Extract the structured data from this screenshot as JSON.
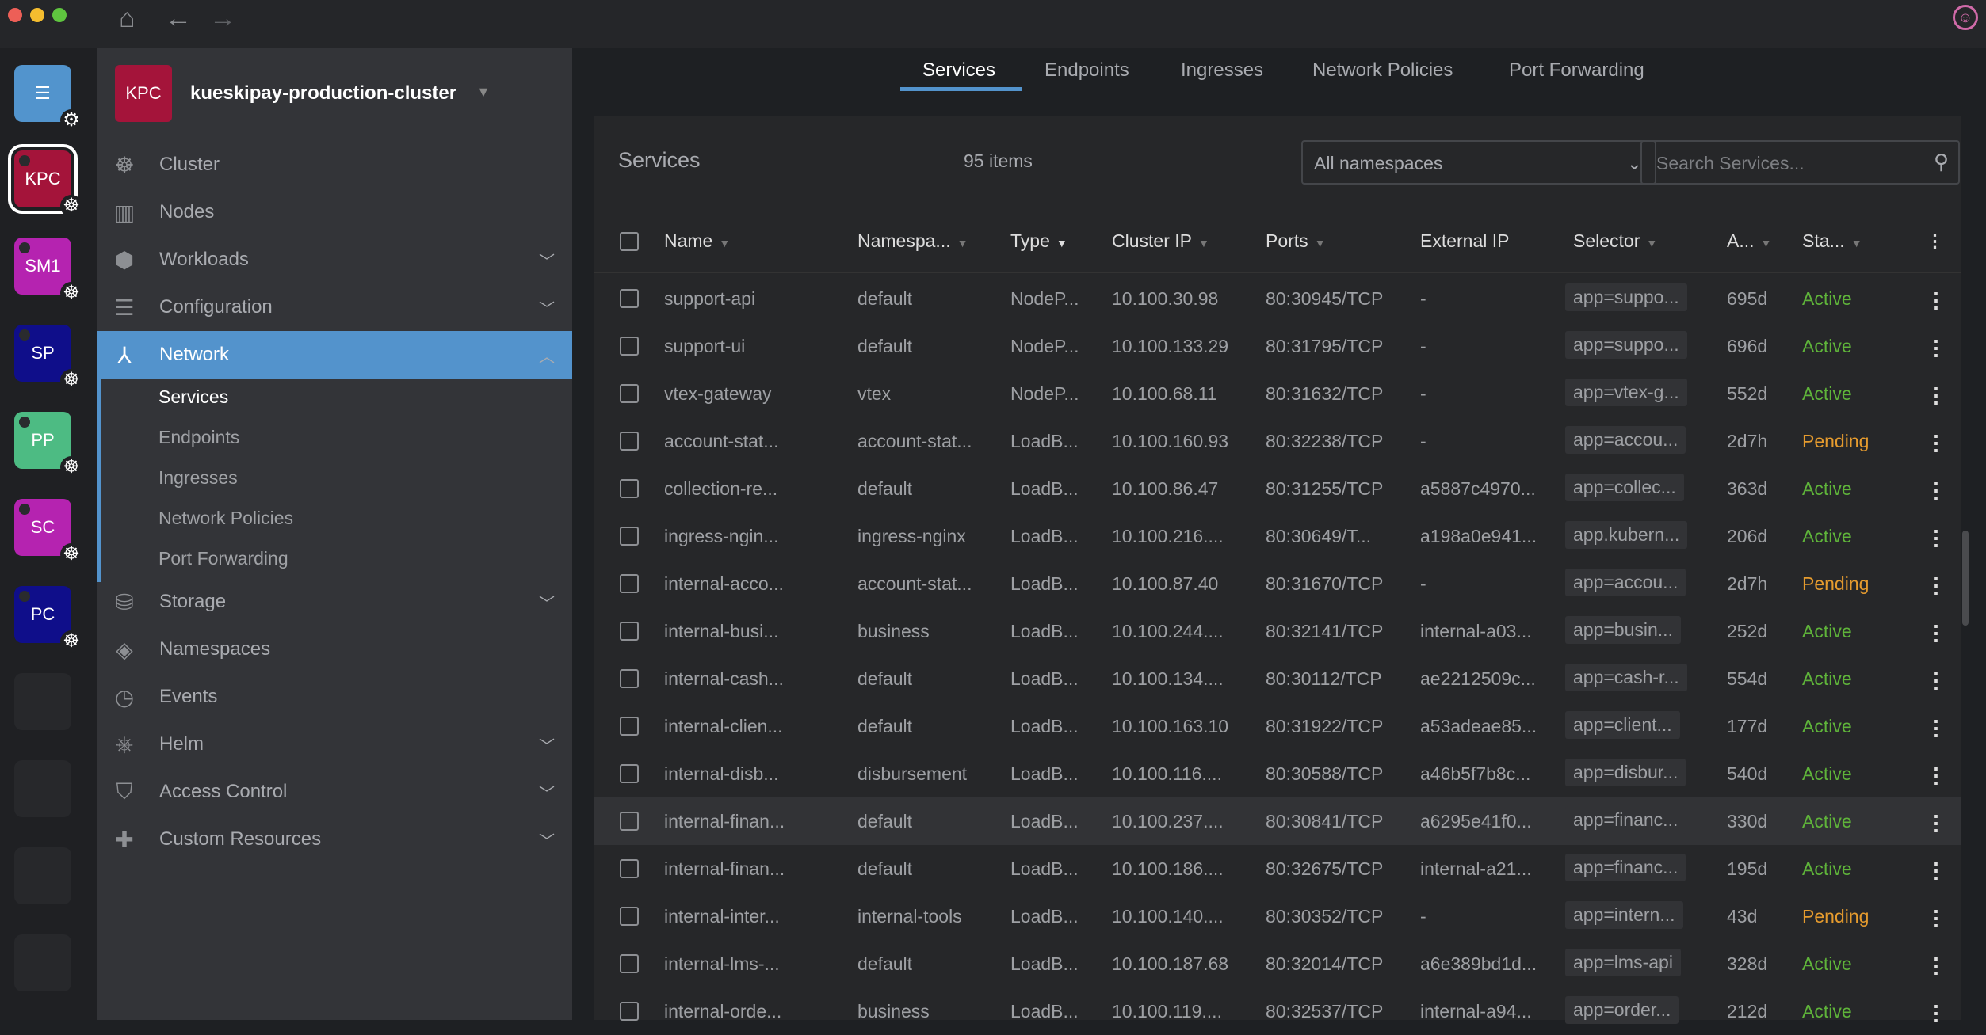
{
  "colors": {
    "accent": "#5393cc",
    "active": "#5fb43a",
    "pending": "#e59b2e"
  },
  "titlebar": {
    "home_icon": "home-icon",
    "back_icon": "arrow-left-icon",
    "forward_icon": "arrow-right-icon",
    "user_icon": "user-avatar-icon"
  },
  "hotbar": [
    {
      "label": "",
      "color": "#5294cd",
      "icon": "catalog-icon"
    },
    {
      "label": "KPC",
      "color": "#a4143a"
    },
    {
      "label": "SM1",
      "color": "#b523b0"
    },
    {
      "label": "SP",
      "color": "#0f0e8a"
    },
    {
      "label": "PP",
      "color": "#4dbb83"
    },
    {
      "label": "SC",
      "color": "#b523b0"
    },
    {
      "label": "PC",
      "color": "#0f0e8a"
    }
  ],
  "cluster": {
    "badge": "KPC",
    "name": "kueskipay-production-cluster"
  },
  "sidebar": {
    "items": [
      {
        "label": "Cluster",
        "icon": "☸",
        "chev": false
      },
      {
        "label": "Nodes",
        "icon": "▥",
        "chev": false
      },
      {
        "label": "Workloads",
        "icon": "⬢",
        "chev": true
      },
      {
        "label": "Configuration",
        "icon": "☰",
        "chev": true
      },
      {
        "label": "Network",
        "icon": "⅄",
        "chev": true,
        "active": true
      },
      {
        "label": "Storage",
        "icon": "⛁",
        "chev": true
      },
      {
        "label": "Namespaces",
        "icon": "◈",
        "chev": false
      },
      {
        "label": "Events",
        "icon": "◷",
        "chev": false
      },
      {
        "label": "Helm",
        "icon": "⎈",
        "chev": true
      },
      {
        "label": "Access Control",
        "icon": "⛉",
        "chev": true
      },
      {
        "label": "Custom Resources",
        "icon": "✚",
        "chev": true
      }
    ],
    "network_sub": [
      "Services",
      "Endpoints",
      "Ingresses",
      "Network Policies",
      "Port Forwarding"
    ]
  },
  "tabs": [
    "Services",
    "Endpoints",
    "Ingresses",
    "Network Policies",
    "Port Forwarding"
  ],
  "panel": {
    "title": "Services",
    "count": "95 items",
    "namespace": "All namespaces",
    "search_placeholder": "Search Services..."
  },
  "columns": [
    "Name",
    "Namespa...",
    "Type",
    "Cluster IP",
    "Ports",
    "External IP",
    "Selector",
    "A...",
    "Sta..."
  ],
  "rows": [
    [
      "support-api",
      "default",
      "NodeP...",
      "10.100.30.98",
      "80:30945/TCP",
      "-",
      "app=suppo...",
      "695d",
      "Active"
    ],
    [
      "support-ui",
      "default",
      "NodeP...",
      "10.100.133.29",
      "80:31795/TCP",
      "-",
      "app=suppo...",
      "696d",
      "Active"
    ],
    [
      "vtex-gateway",
      "vtex",
      "NodeP...",
      "10.100.68.11",
      "80:31632/TCP",
      "-",
      "app=vtex-g...",
      "552d",
      "Active"
    ],
    [
      "account-stat...",
      "account-stat...",
      "LoadB...",
      "10.100.160.93",
      "80:32238/TCP",
      "-",
      "app=accou...",
      "2d7h",
      "Pending"
    ],
    [
      "collection-re...",
      "default",
      "LoadB...",
      "10.100.86.47",
      "80:31255/TCP",
      "a5887c4970...",
      "app=collec...",
      "363d",
      "Active"
    ],
    [
      "ingress-ngin...",
      "ingress-nginx",
      "LoadB...",
      "10.100.216....",
      "80:30649/T...",
      "a198a0e941...",
      "app.kubern...",
      "206d",
      "Active"
    ],
    [
      "internal-acco...",
      "account-stat...",
      "LoadB...",
      "10.100.87.40",
      "80:31670/TCP",
      "-",
      "app=accou...",
      "2d7h",
      "Pending"
    ],
    [
      "internal-busi...",
      "business",
      "LoadB...",
      "10.100.244....",
      "80:32141/TCP",
      "internal-a03...",
      "app=busin...",
      "252d",
      "Active"
    ],
    [
      "internal-cash...",
      "default",
      "LoadB...",
      "10.100.134....",
      "80:30112/TCP",
      "ae2212509c...",
      "app=cash-r...",
      "554d",
      "Active"
    ],
    [
      "internal-clien...",
      "default",
      "LoadB...",
      "10.100.163.10",
      "80:31922/TCP",
      "a53adeae85...",
      "app=client...",
      "177d",
      "Active"
    ],
    [
      "internal-disb...",
      "disbursement",
      "LoadB...",
      "10.100.116....",
      "80:30588/TCP",
      "a46b5f7b8c...",
      "app=disbur...",
      "540d",
      "Active"
    ],
    [
      "internal-finan...",
      "default",
      "LoadB...",
      "10.100.237....",
      "80:30841/TCP",
      "a6295e41f0...",
      "app=financ...",
      "330d",
      "Active"
    ],
    [
      "internal-finan...",
      "default",
      "LoadB...",
      "10.100.186....",
      "80:32675/TCP",
      "internal-a21...",
      "app=financ...",
      "195d",
      "Active"
    ],
    [
      "internal-inter...",
      "internal-tools",
      "LoadB...",
      "10.100.140....",
      "80:30352/TCP",
      "-",
      "app=intern...",
      "43d",
      "Pending"
    ],
    [
      "internal-lms-...",
      "default",
      "LoadB...",
      "10.100.187.68",
      "80:32014/TCP",
      "a6e389bd1d...",
      "app=lms-api",
      "328d",
      "Active"
    ],
    [
      "internal-orde...",
      "business",
      "LoadB...",
      "10.100.119....",
      "80:32537/TCP",
      "internal-a94...",
      "app=order...",
      "212d",
      "Active"
    ]
  ]
}
